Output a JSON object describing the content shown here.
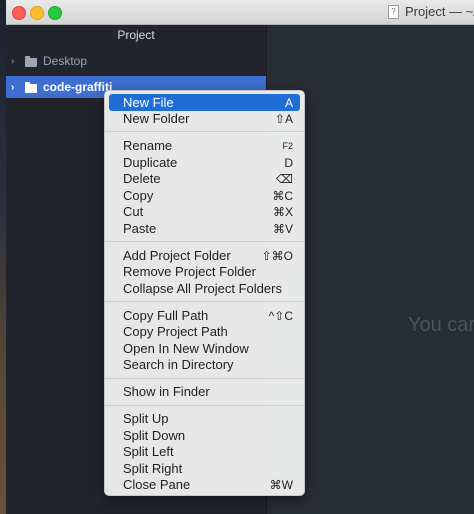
{
  "window": {
    "title": "Project — ~/D"
  },
  "tree": {
    "header": "Project",
    "items": [
      {
        "label": "Desktop",
        "selected": false
      },
      {
        "label": "code-graffiti",
        "selected": true
      }
    ]
  },
  "editor": {
    "hint": "You car"
  },
  "context_menu": {
    "groups": [
      [
        {
          "label": "New File",
          "shortcut": "A",
          "highlighted": true
        },
        {
          "label": "New Folder",
          "shortcut": "⇧A"
        }
      ],
      [
        {
          "label": "Rename",
          "shortcut": "F2"
        },
        {
          "label": "Duplicate",
          "shortcut": "D"
        },
        {
          "label": "Delete",
          "shortcut": "⌫"
        },
        {
          "label": "Copy",
          "shortcut": "⌘C"
        },
        {
          "label": "Cut",
          "shortcut": "⌘X"
        },
        {
          "label": "Paste",
          "shortcut": "⌘V"
        }
      ],
      [
        {
          "label": "Add Project Folder",
          "shortcut": "⇧⌘O"
        },
        {
          "label": "Remove Project Folder",
          "shortcut": ""
        },
        {
          "label": "Collapse All Project Folders",
          "shortcut": ""
        }
      ],
      [
        {
          "label": "Copy Full Path",
          "shortcut": "^⇧C"
        },
        {
          "label": "Copy Project Path",
          "shortcut": ""
        },
        {
          "label": "Open In New Window",
          "shortcut": ""
        },
        {
          "label": "Search in Directory",
          "shortcut": ""
        }
      ],
      [
        {
          "label": "Show in Finder",
          "shortcut": ""
        }
      ],
      [
        {
          "label": "Split Up",
          "shortcut": ""
        },
        {
          "label": "Split Down",
          "shortcut": ""
        },
        {
          "label": "Split Left",
          "shortcut": ""
        },
        {
          "label": "Split Right",
          "shortcut": ""
        },
        {
          "label": "Close Pane",
          "shortcut": "⌘W"
        }
      ]
    ]
  },
  "colors": {
    "selection": "#3e6fd0",
    "menu_highlight": "#1f6ed8",
    "tree_bg": "#21252b",
    "editor_bg": "#282c34"
  }
}
